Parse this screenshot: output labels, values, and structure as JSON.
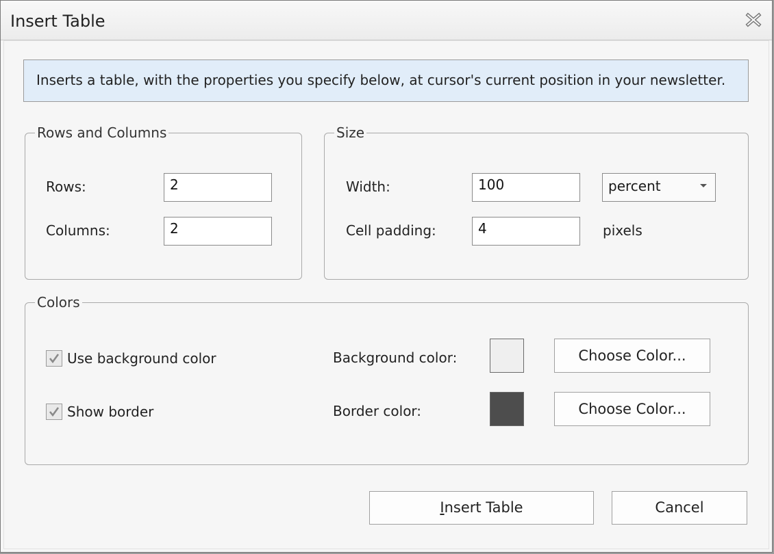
{
  "window": {
    "title": "Insert Table",
    "close_icon": "close-icon"
  },
  "info": {
    "text": "Inserts a table, with the properties you specify below, at cursor's current position in your newsletter."
  },
  "rows_columns": {
    "legend": "Rows and Columns",
    "rows_label": "Rows:",
    "rows_value": "2",
    "columns_label": "Columns:",
    "columns_value": "2"
  },
  "size": {
    "legend": "Size",
    "width_label": "Width:",
    "width_value": "100",
    "unit_selected": "percent",
    "cell_padding_label": "Cell padding:",
    "cell_padding_value": "4",
    "cell_padding_unit": "pixels"
  },
  "colors": {
    "legend": "Colors",
    "use_bg_label": "Use background color",
    "use_bg_checked": true,
    "show_border_label": "Show border",
    "show_border_checked": true,
    "bg_color_label": "Background color:",
    "bg_color": "#efefef",
    "border_color_label": "Border color:",
    "border_color": "#4d4d4d",
    "choose_color_label": "Choose Color..."
  },
  "footer": {
    "insert_label": "Insert Table",
    "cancel_label": "Cancel"
  }
}
